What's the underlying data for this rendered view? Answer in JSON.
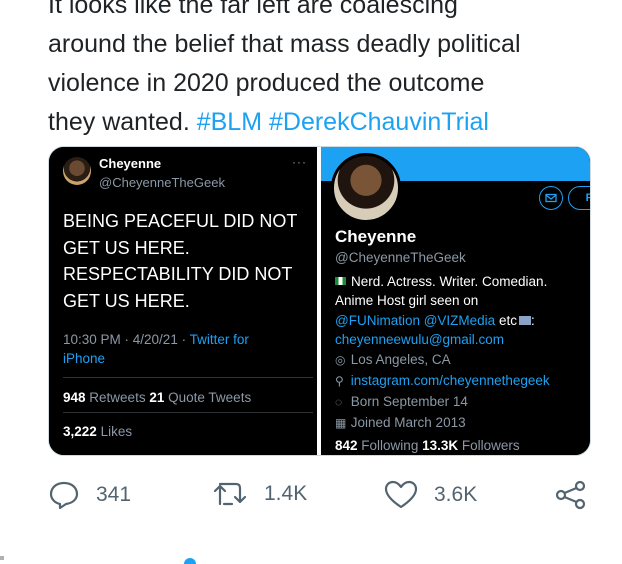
{
  "tweet": {
    "line0": "It looks like the far left are coalescing",
    "line1": "around the belief that mass deadly political",
    "line2": "violence in 2020 produced the outcome",
    "line3_text": "they wanted.",
    "hashtag1": "#BLM",
    "hashtag2": "#DerekChauvinTrial"
  },
  "quoted": {
    "name": "Cheyenne",
    "handle": "@CheyenneTheGeek",
    "more": "···",
    "body": [
      "BEING PEACEFUL DID NOT",
      "GET US HERE.",
      "RESPECTABILITY DID NOT",
      "GET US HERE."
    ],
    "timestamp": "10:30 PM · 4/20/21 ·",
    "client": "Twitter for iPhone",
    "client_a": "Twitter for",
    "client_b": "iPhone",
    "retweets_count": "948",
    "retweets_label": "Retweets",
    "quotes_count": "21",
    "quotes_label": "Quote Tweets",
    "likes_count": "3,222",
    "likes_label": "Likes"
  },
  "profile": {
    "follow_label": "Follow",
    "name": "Cheyenne",
    "handle": "@CheyenneTheGeek",
    "bio1": "Nerd. Actress. Writer. Comedian.",
    "bio2": "Anime Host girl seen on",
    "bio3_link": "@FUNimation @VIZMedia",
    "bio3_rest": "etc",
    "email": "cheyenneewulu@gmail.com",
    "location": "Los Angeles, CA",
    "website": "instagram.com/cheyennethegeek",
    "birthday": "Born September 14",
    "joined": "Joined March 2013",
    "following_count": "842",
    "following_label": "Following",
    "followers_count": "13.3K",
    "followers_label": "Followers"
  },
  "actions": {
    "replies": "341",
    "retweets": "1.4K",
    "likes": "3.6K"
  },
  "icons": [
    "reply-icon",
    "retweet-icon",
    "like-icon",
    "share-icon",
    "location-icon",
    "link-icon",
    "birthday-icon",
    "calendar-icon",
    "mail-icon"
  ],
  "colors": {
    "accent": "#1da1f2",
    "text": "#1f2326",
    "muted": "#536471",
    "dark_bg": "#000000"
  }
}
